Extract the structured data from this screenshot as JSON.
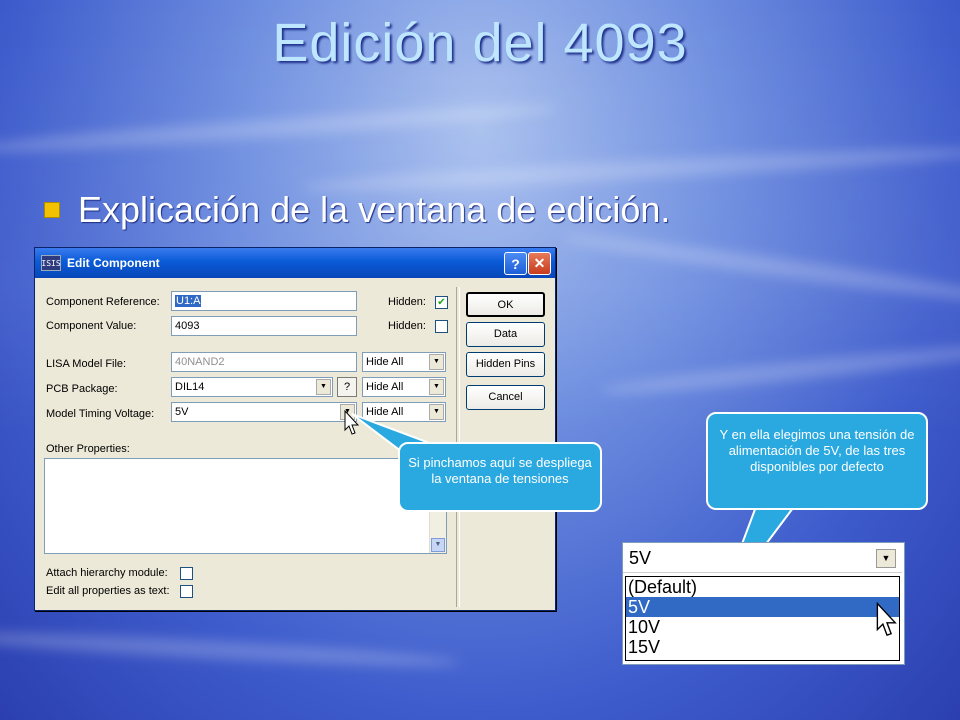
{
  "slide": {
    "title": "Edición del 4093",
    "bullet": "Explicación de la ventana de edición."
  },
  "dialog": {
    "app_icon": "ISIS",
    "title": "Edit Component",
    "help_label": "?",
    "close_label": "✕",
    "fields": {
      "component_reference": {
        "label": "Component Reference:",
        "value": "U1:A",
        "hidden_label": "Hidden:",
        "hidden_checked": true
      },
      "component_value": {
        "label": "Component Value:",
        "value": "4093",
        "hidden_label": "Hidden:",
        "hidden_checked": false
      },
      "lisa_model_file": {
        "label": "LISA Model File:",
        "value": "40NAND2",
        "visibility": "Hide All"
      },
      "pcb_package": {
        "label": "PCB Package:",
        "value": "DIL14",
        "help": "?",
        "visibility": "Hide All"
      },
      "model_timing_voltage": {
        "label": "Model Timing Voltage:",
        "value": "5V",
        "visibility": "Hide All"
      }
    },
    "other_properties_label": "Other Properties:",
    "attach_hierarchy_label": "Attach hierarchy module:",
    "edit_all_label": "Edit all properties as text:",
    "buttons": {
      "ok": "OK",
      "data": "Data",
      "hidden_pins": "Hidden Pins",
      "cancel": "Cancel"
    }
  },
  "callouts": {
    "left": "Si pinchamos aquí se despliega la ventana de tensiones",
    "right": "Y en ella elegimos una tensión de alimentación de 5V, de las tres disponibles por defecto"
  },
  "dropdown": {
    "selected": "5V",
    "options": [
      "(Default)",
      "5V",
      "10V",
      "15V"
    ],
    "highlighted_index": 1
  },
  "colors": {
    "title": "#bfe6ff",
    "bullet": "#f2c200",
    "callout": "#2aa9e0",
    "selection": "#316ac5"
  }
}
